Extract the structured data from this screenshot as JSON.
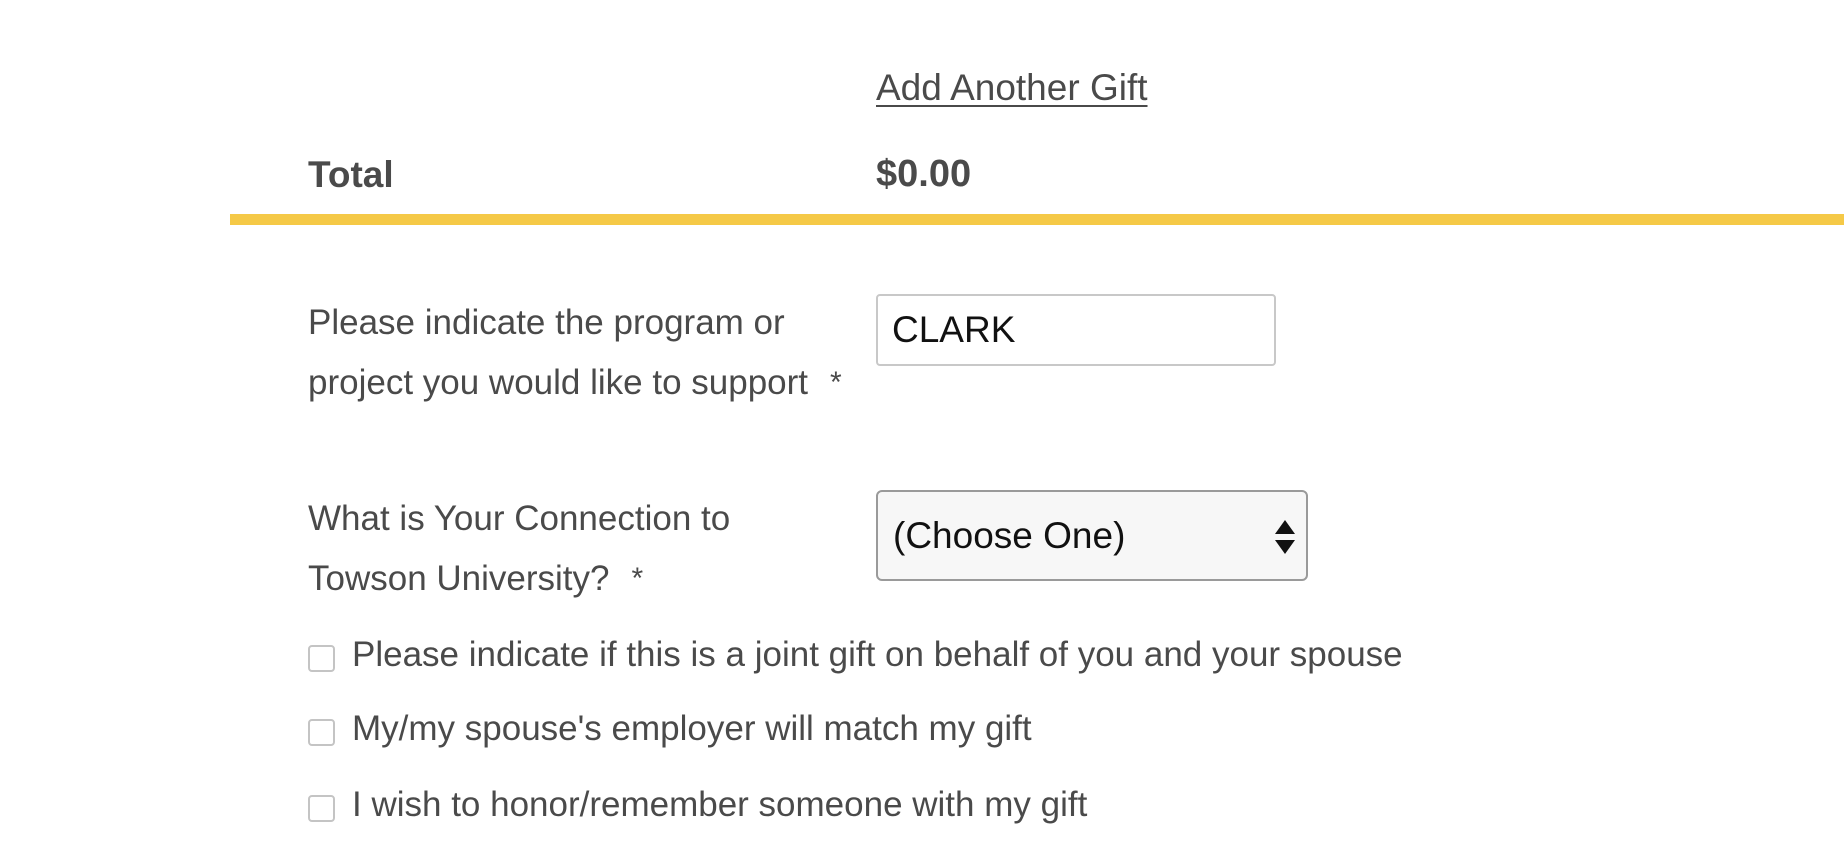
{
  "gift": {
    "add_another_label": "Add Another Gift"
  },
  "total": {
    "label": "Total",
    "value": "$0.00"
  },
  "colors": {
    "divider": "#f5c947",
    "text": "#4a4a4a"
  },
  "program_field": {
    "label": "Please indicate the program or project you would like to support",
    "required_marker": "*",
    "value": "CLARK"
  },
  "connection_field": {
    "label": "What is Your Connection to Towson University?",
    "required_marker": "*",
    "selected": "(Choose One)",
    "icon": "select-arrows-icon"
  },
  "checkboxes": [
    {
      "label": "Please indicate if this is a joint gift on behalf of you and your spouse",
      "checked": false
    },
    {
      "label": "My/my spouse's employer will match my gift",
      "checked": false
    },
    {
      "label": "I wish to honor/remember someone with my gift",
      "checked": false
    }
  ]
}
